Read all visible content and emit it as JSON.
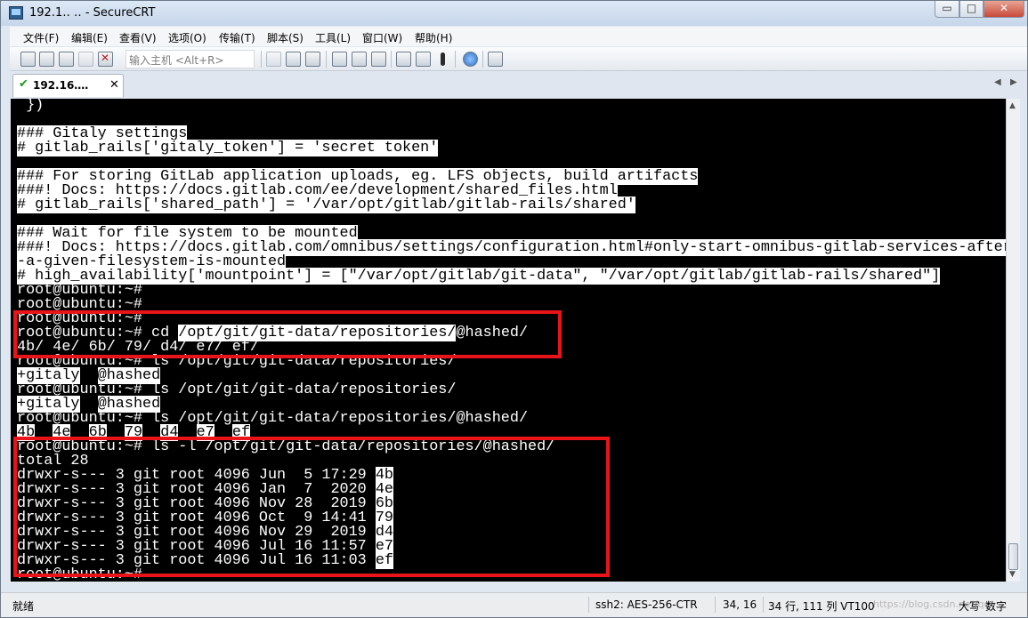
{
  "window": {
    "title": "192.1‥  ‥ - SecureCRT",
    "min_label": "▭",
    "max_label": "□",
    "close_label": "✕"
  },
  "menu": [
    "文件(F)",
    "编辑(E)",
    "查看(V)",
    "选项(O)",
    "传输(T)",
    "脚本(S)",
    "工具(L)",
    "窗口(W)",
    "帮助(H)"
  ],
  "toolbar": {
    "host_placeholder": "输入主机 <Alt+R>"
  },
  "tab": {
    "label": "192.16‥‥",
    "close": "✕"
  },
  "terminal": {
    "lines": [
      [
        [
          " })",
          false
        ]
      ],
      [
        [
          "",
          false
        ]
      ],
      [
        [
          "### Gitaly settings",
          true
        ]
      ],
      [
        [
          "# gitlab_rails['gitaly_token'] = 'secret token'",
          true
        ]
      ],
      [
        [
          "",
          false
        ]
      ],
      [
        [
          "### For storing GitLab application uploads, eg. LFS objects, build artifacts",
          true
        ]
      ],
      [
        [
          "###! Docs: https://docs.gitlab.com/ee/development/shared_files.html",
          true
        ]
      ],
      [
        [
          "# gitlab_rails['shared_path'] = '/var/opt/gitlab/gitlab-rails/shared'",
          true
        ]
      ],
      [
        [
          "",
          false
        ]
      ],
      [
        [
          "### Wait for file system to be mounted",
          true
        ]
      ],
      [
        [
          "###! Docs: https://docs.gitlab.com/omnibus/settings/configuration.html#only-start-omnibus-gitlab-services-after",
          true
        ]
      ],
      [
        [
          "-a-given-filesystem-is-mounted",
          true
        ]
      ],
      [
        [
          "# high_availability['mountpoint'] = [\"/var/opt/gitlab/git-data\", \"/var/opt/gitlab/gitlab-rails/shared\"]",
          true
        ]
      ],
      [
        [
          "root@ubuntu:~#",
          false
        ]
      ],
      [
        [
          "root@ubuntu:~#",
          false
        ]
      ],
      [
        [
          "root@ubuntu:~#",
          false
        ]
      ],
      [
        [
          "root@ubuntu:~# cd ",
          false
        ],
        [
          "/opt/git/git-data/repositories/",
          true
        ],
        [
          "@hashed/",
          false
        ]
      ],
      [
        [
          "4b/ 4e/ 6b/ 79/ d4/ e7/ ef/",
          false
        ]
      ],
      [
        [
          "root@ubuntu:~# ls /opt/git/git-data/repositories/",
          false
        ]
      ],
      [
        [
          "+gitaly",
          true
        ],
        [
          "  ",
          false
        ],
        [
          "@hashed",
          true
        ]
      ],
      [
        [
          "root@ubuntu:~# ls /opt/git/git-data/repositories/",
          false
        ]
      ],
      [
        [
          "+gitaly",
          true
        ],
        [
          "  ",
          false
        ],
        [
          "@hashed",
          true
        ]
      ],
      [
        [
          "root@ubuntu:~# ls /opt/git/git-data/repositories/@hashed/",
          false
        ]
      ],
      [
        [
          "4b",
          true
        ],
        [
          "  ",
          false
        ],
        [
          "4e",
          true
        ],
        [
          "  ",
          false
        ],
        [
          "6b",
          true
        ],
        [
          "  ",
          false
        ],
        [
          "79",
          true
        ],
        [
          "  ",
          false
        ],
        [
          "d4",
          true
        ],
        [
          "  ",
          false
        ],
        [
          "e7",
          true
        ],
        [
          "  ",
          false
        ],
        [
          "ef",
          true
        ]
      ],
      [
        [
          "root@ubuntu:~# ls -l /opt/git/git-data/repositories/@hashed/",
          false
        ]
      ],
      [
        [
          "total 28",
          false
        ]
      ],
      [
        [
          "drwxr-s--- 3 git root 4096 Jun  5 17:29 ",
          false
        ],
        [
          "4b",
          true
        ]
      ],
      [
        [
          "drwxr-s--- 3 git root 4096 Jan  7  2020 ",
          false
        ],
        [
          "4e",
          true
        ]
      ],
      [
        [
          "drwxr-s--- 3 git root 4096 Nov 28  2019 ",
          false
        ],
        [
          "6b",
          true
        ]
      ],
      [
        [
          "drwxr-s--- 3 git root 4096 Oct  9 14:41 ",
          false
        ],
        [
          "79",
          true
        ]
      ],
      [
        [
          "drwxr-s--- 3 git root 4096 Nov 29  2019 ",
          false
        ],
        [
          "d4",
          true
        ]
      ],
      [
        [
          "drwxr-s--- 3 git root 4096 Jul 16 11:57 ",
          false
        ],
        [
          "e7",
          true
        ]
      ],
      [
        [
          "drwxr-s--- 3 git root 4096 Jul 16 11:03 ",
          false
        ],
        [
          "ef",
          true
        ]
      ],
      [
        [
          "root@ubuntu:~#",
          false
        ]
      ]
    ]
  },
  "status": {
    "ready": "就绪",
    "cipher": "ssh2: AES-256-CTR",
    "cursor": "34,  16",
    "rows_cols": "34 行, 111 列  VT100",
    "caps": "大写",
    "num": "数字",
    "watermark": "https://blog.csdn.net/qq_..."
  },
  "colors": {
    "highlight_box": "#e8141a",
    "terminal_bg": "#000000",
    "terminal_fg": "#ffffff"
  }
}
